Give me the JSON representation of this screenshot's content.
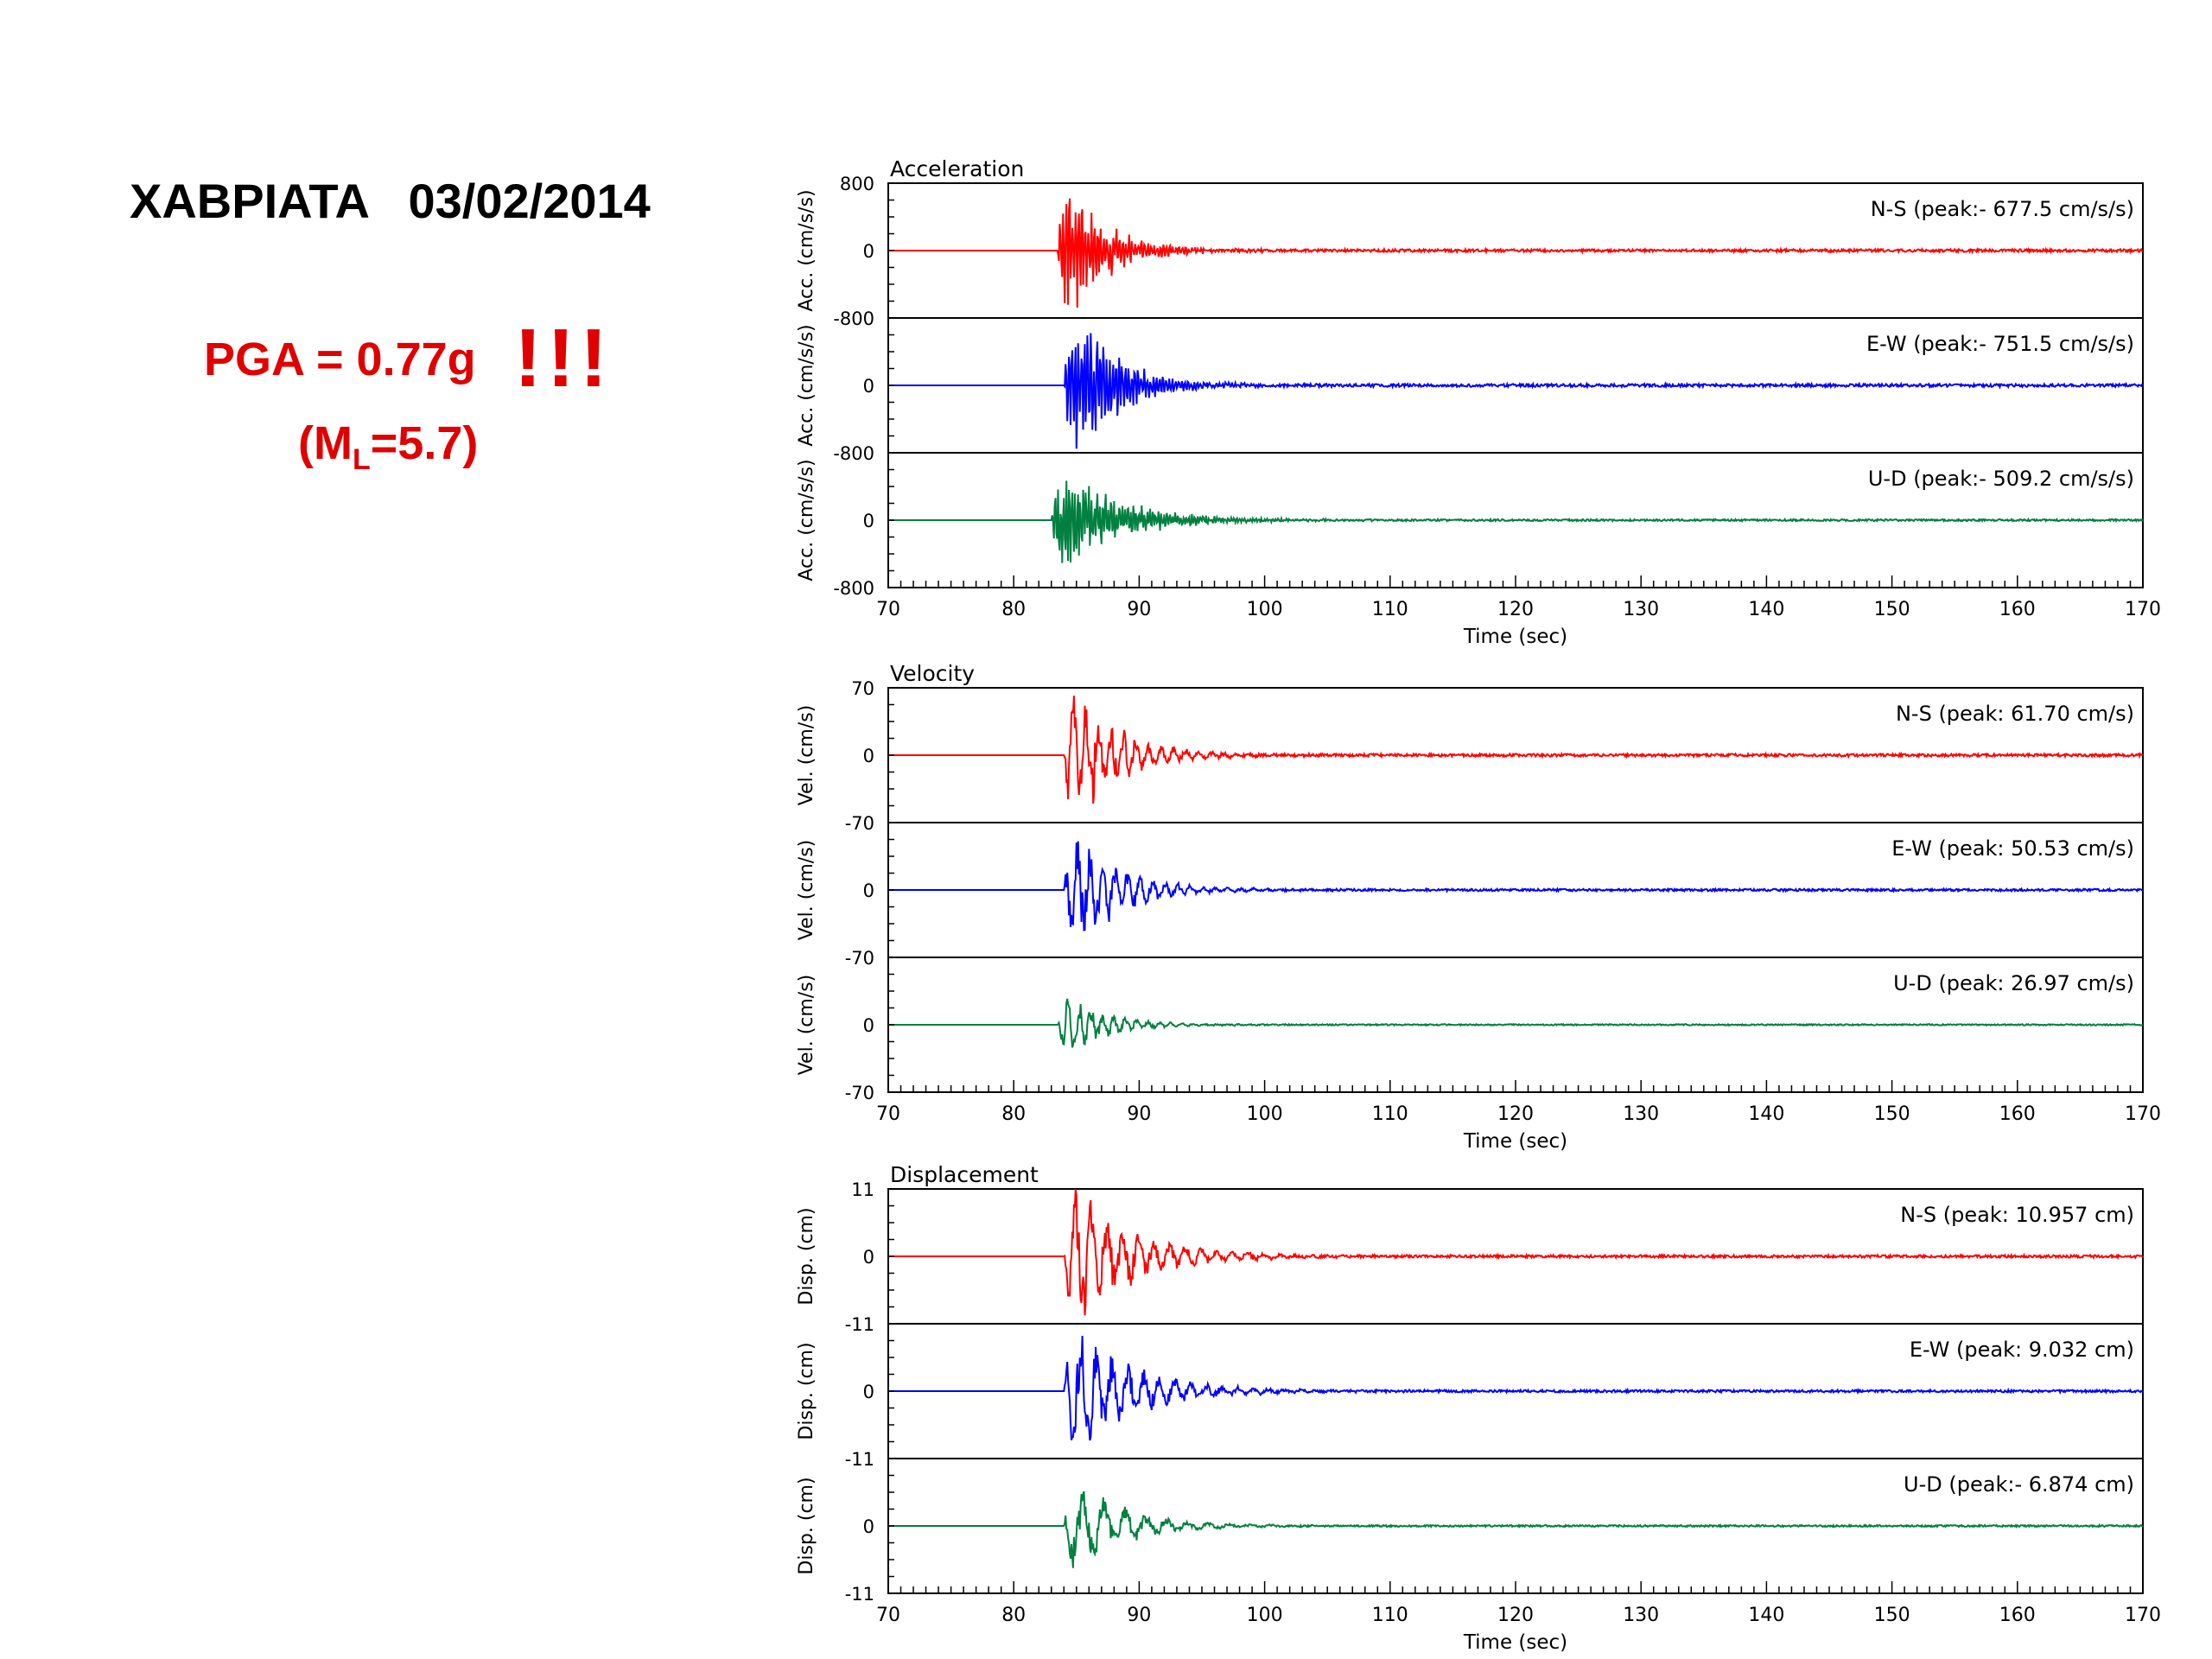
{
  "header": {
    "station_date": "XABPIATA   03/02/2014",
    "pga_text": "PGA = 0.77g",
    "exclaim": "!!!",
    "ml_open": "(M",
    "ml_sub": "L",
    "ml_close": "=5.7)"
  },
  "colors": {
    "ns": "#ff0000",
    "ew": "#0000ff",
    "ud": "#008040",
    "axis": "#000000"
  },
  "chart_data": [
    {
      "type": "line",
      "title": "Acceleration",
      "xlabel": "Time (sec)",
      "ylabel": "Acc. (cm/s/s)",
      "xlim": [
        70,
        170
      ],
      "xticks": [
        70,
        80,
        90,
        100,
        110,
        120,
        130,
        140,
        150,
        160,
        170
      ],
      "ylim": [
        -800,
        800
      ],
      "ytick_labels": [
        "800",
        "0",
        "-800"
      ],
      "grid": false,
      "series": [
        {
          "component": "N-S",
          "label": "N-S (peak:- 677.5 cm/s/s)",
          "peak": -677.5,
          "color": "#ff0000",
          "onset": 83.5,
          "decay": 0.32,
          "freq": 4.0,
          "scale": 0.75
        },
        {
          "component": "E-W",
          "label": "E-W (peak:- 751.5 cm/s/s)",
          "peak": -751.5,
          "color": "#0000ff",
          "onset": 84.0,
          "decay": 0.3,
          "freq": 4.0,
          "scale": 0.75
        },
        {
          "component": "U-D",
          "label": "U-D (peak:- 509.2 cm/s/s)",
          "peak": -509.2,
          "color": "#008040",
          "onset": 83.0,
          "decay": 0.22,
          "freq": 4.5,
          "scale": 0.75
        }
      ]
    },
    {
      "type": "line",
      "title": "Velocity",
      "xlabel": "Time (sec)",
      "ylabel": "Vel. (cm/s)",
      "xlim": [
        70,
        170
      ],
      "xticks": [
        70,
        80,
        90,
        100,
        110,
        120,
        130,
        140,
        150,
        160,
        170
      ],
      "ylim": [
        -70,
        70
      ],
      "ytick_labels": [
        "70",
        "0",
        "-70"
      ],
      "grid": false,
      "series": [
        {
          "component": "N-S",
          "label": "N-S (peak: 61.70 cm/s)",
          "peak": 61.7,
          "color": "#ff0000",
          "onset": 84.0,
          "decay": 0.3,
          "freq": 1.0,
          "scale": 1.0
        },
        {
          "component": "E-W",
          "label": "E-W (peak: 50.53 cm/s)",
          "peak": 50.53,
          "color": "#0000ff",
          "onset": 84.0,
          "decay": 0.28,
          "freq": 1.0,
          "scale": 1.0
        },
        {
          "component": "U-D",
          "label": "U-D (peak: 26.97 cm/s)",
          "peak": 26.97,
          "color": "#008040",
          "onset": 83.5,
          "decay": 0.33,
          "freq": 1.1,
          "scale": 1.0
        }
      ]
    },
    {
      "type": "line",
      "title": "Displacement",
      "xlabel": "Time (sec)",
      "ylabel": "Disp. (cm)",
      "xlim": [
        70,
        170
      ],
      "xticks": [
        70,
        80,
        90,
        100,
        110,
        120,
        130,
        140,
        150,
        160,
        170
      ],
      "ylim": [
        -11,
        11
      ],
      "ytick_labels": [
        "11",
        "0",
        "-11"
      ],
      "grid": false,
      "series": [
        {
          "component": "N-S",
          "label": "N-S (peak: 10.957 cm)",
          "peak": 10.957,
          "color": "#ff0000",
          "onset": 84.0,
          "decay": 0.22,
          "freq": 0.8,
          "scale": 1.0
        },
        {
          "component": "E-W",
          "label": "E-W (peak: 9.032 cm)",
          "peak": 9.032,
          "color": "#0000ff",
          "onset": 84.0,
          "decay": 0.22,
          "freq": 0.8,
          "scale": 1.0
        },
        {
          "component": "U-D",
          "label": "U-D (peak:- 6.874 cm)",
          "peak": -6.874,
          "color": "#008040",
          "onset": 84.0,
          "decay": 0.25,
          "freq": 0.6,
          "scale": 1.0
        }
      ]
    }
  ]
}
